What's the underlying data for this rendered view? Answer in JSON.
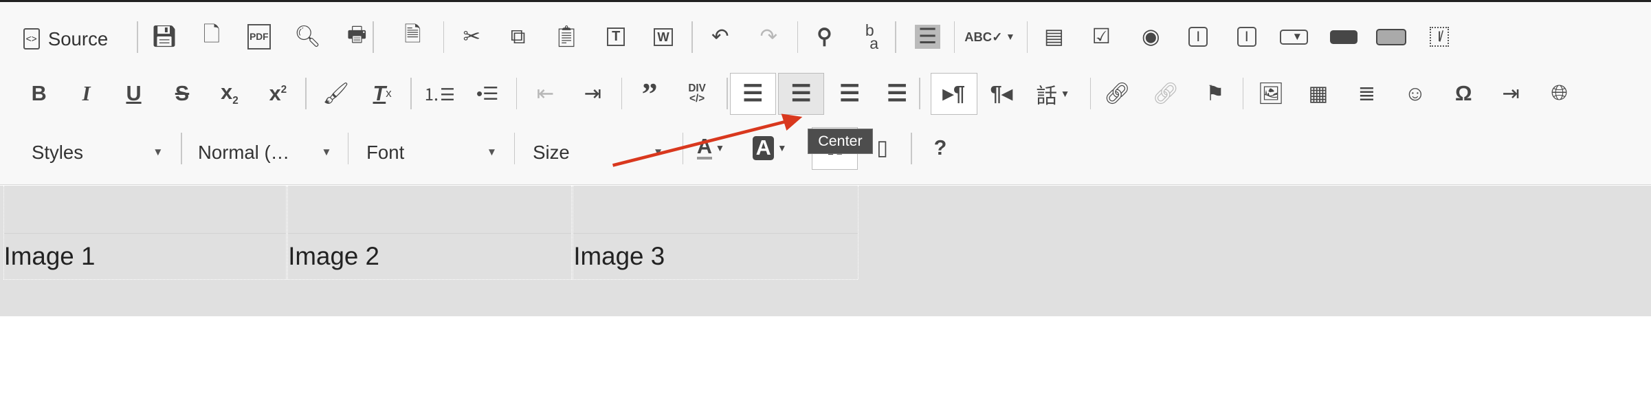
{
  "toolbar": {
    "source_label": "Source",
    "row1": [
      "save-icon",
      "new-page-icon",
      "export-pdf-icon",
      "preview-icon",
      "print-icon",
      "templates-icon",
      "cut-icon",
      "copy-icon",
      "paste-icon",
      "paste-text-icon",
      "paste-from-word-icon",
      "undo-icon",
      "redo-icon",
      "find-icon",
      "replace-icon",
      "select-all-icon",
      "spellcheck-icon",
      "form-icon",
      "checkbox-icon",
      "radio-icon",
      "text-field-icon",
      "textarea-icon",
      "select-icon",
      "button-icon",
      "image-button-icon",
      "hidden-field-icon"
    ],
    "row2": [
      "bold-icon",
      "italic-icon",
      "underline-icon",
      "strikethrough-icon",
      "subscript-icon",
      "superscript-icon",
      "copy-formatting-icon",
      "remove-format-icon",
      "numbered-list-icon",
      "bulleted-list-icon",
      "outdent-icon",
      "indent-icon",
      "blockquote-icon",
      "create-div-icon",
      "align-left-icon",
      "align-center-icon",
      "align-right-icon",
      "justify-icon",
      "text-direction-ltr-icon",
      "text-direction-rtl-icon",
      "language-icon",
      "link-icon",
      "unlink-icon",
      "anchor-icon",
      "image-icon",
      "table-icon",
      "horizontal-line-icon",
      "smiley-icon",
      "special-char-icon",
      "page-break-icon",
      "iframe-icon"
    ],
    "row3_icons": [
      "text-color-icon",
      "background-color-icon",
      "maximize-icon",
      "show-blocks-icon",
      "help-icon"
    ],
    "combos": {
      "styles": "Styles",
      "format": "Normal (…",
      "font": "Font",
      "size": "Size"
    },
    "tooltip": "Center",
    "active_button": "align-center",
    "annotation_arrow_color": "#d9381e"
  },
  "content": {
    "cells": [
      "Image 1",
      "Image 2",
      "Image 3"
    ]
  }
}
